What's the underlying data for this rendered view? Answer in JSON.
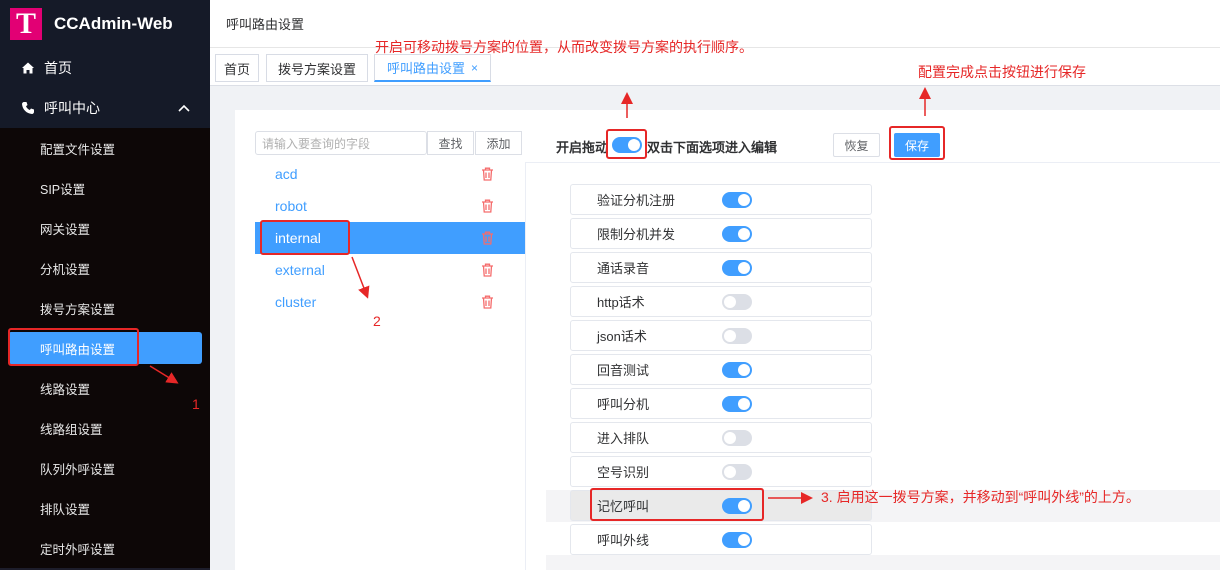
{
  "app": {
    "logo_letter": "T",
    "title": "CCAdmin-Web"
  },
  "sidebar": {
    "home": "首页",
    "call_center": "呼叫中心",
    "items": [
      {
        "label": "配置文件设置"
      },
      {
        "label": "SIP设置"
      },
      {
        "label": "网关设置"
      },
      {
        "label": "分机设置"
      },
      {
        "label": "拨号方案设置"
      },
      {
        "label": "呼叫路由设置",
        "active": true
      },
      {
        "label": "线路设置"
      },
      {
        "label": "线路组设置"
      },
      {
        "label": "队列外呼设置"
      },
      {
        "label": "排队设置"
      },
      {
        "label": "定时外呼设置"
      }
    ]
  },
  "header": {
    "breadcrumb": "呼叫路由设置"
  },
  "tabs": [
    {
      "label": "首页"
    },
    {
      "label": "拨号方案设置"
    },
    {
      "label": "呼叫路由设置",
      "active": true,
      "close": "×"
    }
  ],
  "left_panel": {
    "search_placeholder": "请输入要查询的字段",
    "find_button": "查找",
    "add_button": "添加",
    "items": [
      {
        "label": "acd"
      },
      {
        "label": "robot"
      },
      {
        "label": "internal",
        "active": true
      },
      {
        "label": "external"
      },
      {
        "label": "cluster"
      }
    ]
  },
  "editor": {
    "drag_label": "开启拖动",
    "drag_enabled": true,
    "hint": "双击下面选项进入编辑",
    "reset_button": "恢复",
    "save_button": "保存",
    "options": [
      {
        "label": "验证分机注册",
        "on": true
      },
      {
        "label": "限制分机并发",
        "on": true
      },
      {
        "label": "通话录音",
        "on": true
      },
      {
        "label": "http话术",
        "on": false
      },
      {
        "label": "json话术",
        "on": false
      },
      {
        "label": "回音测试",
        "on": true
      },
      {
        "label": "呼叫分机",
        "on": true
      },
      {
        "label": "进入排队",
        "on": false
      },
      {
        "label": "空号识别",
        "on": false
      },
      {
        "label": "记忆呼叫",
        "on": true
      },
      {
        "label": "呼叫外线",
        "on": true
      }
    ]
  },
  "annotations": {
    "top_note": "开启可移动拨号方案的位置，从而改变拨号方案的执行顺序。",
    "save_note": "配置完成点击按钮进行保存",
    "step1": "1",
    "step2": "2",
    "step3": "3. 启用这一拨号方案，并移动到“呼叫外线”的上方。"
  },
  "colors": {
    "accent": "#409eff",
    "annotation": "#e62727",
    "brand": "#e20074"
  }
}
